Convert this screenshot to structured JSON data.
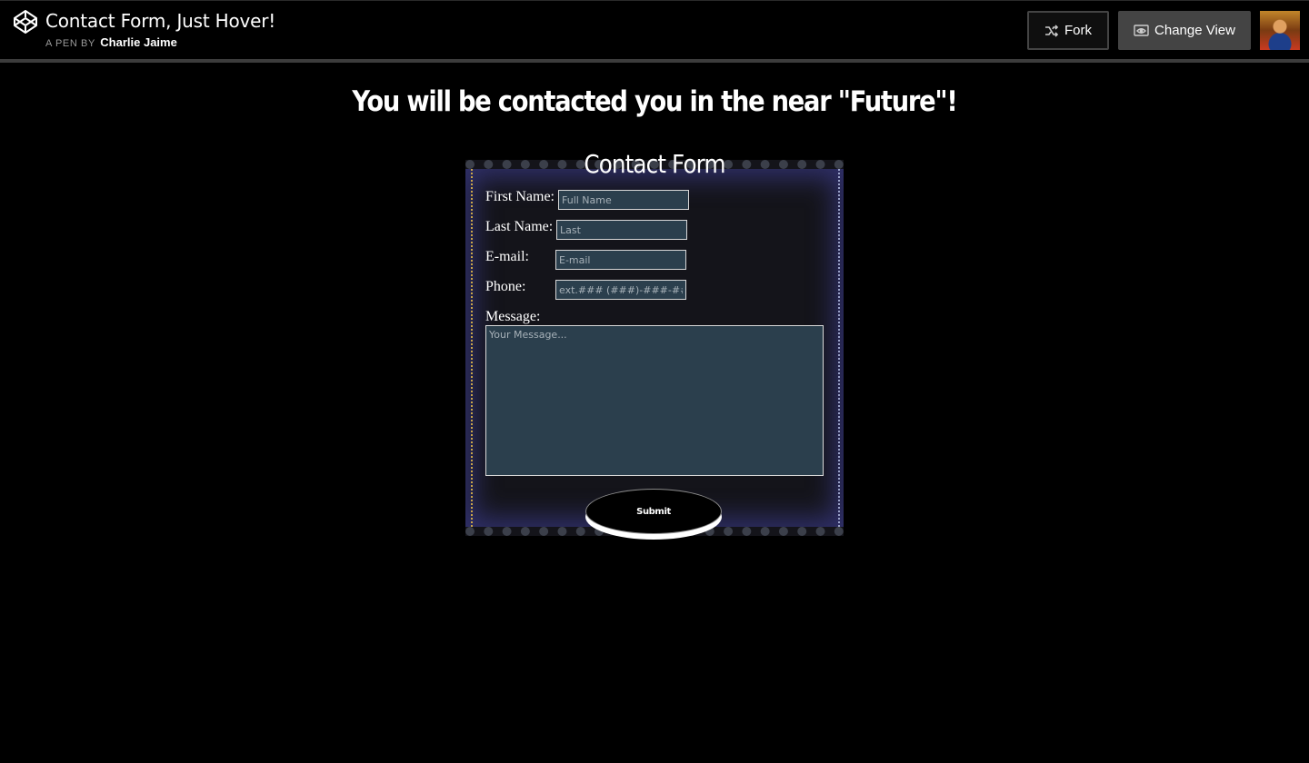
{
  "header": {
    "title": "Contact Form, Just Hover!",
    "byline_prefix": "A PEN BY",
    "author": "Charlie Jaime",
    "fork_label": "Fork",
    "change_view_label": "Change View"
  },
  "page": {
    "headline": "You will be contacted you in the near \"Future\"!"
  },
  "form": {
    "title": "Contact Form",
    "first_name": {
      "label": "First Name:",
      "placeholder": "Full Name",
      "value": ""
    },
    "last_name": {
      "label": "Last Name:",
      "placeholder": "Last",
      "value": ""
    },
    "email": {
      "label": "E-mail:",
      "placeholder": "E-mail",
      "value": ""
    },
    "phone": {
      "label": "Phone:",
      "placeholder": "ext.### (###)-###-####",
      "value": ""
    },
    "message": {
      "label": "Message:",
      "placeholder": "Your Message...",
      "value": ""
    },
    "submit_label": "Submit"
  },
  "colors": {
    "background": "#000000",
    "input_fill": "#2b3f4d",
    "form_glow": "#30306a",
    "view_button": "#444444"
  },
  "icons": {
    "logo": "codepen-logo-icon",
    "fork": "fork-icon",
    "change_view": "eye-window-icon"
  }
}
